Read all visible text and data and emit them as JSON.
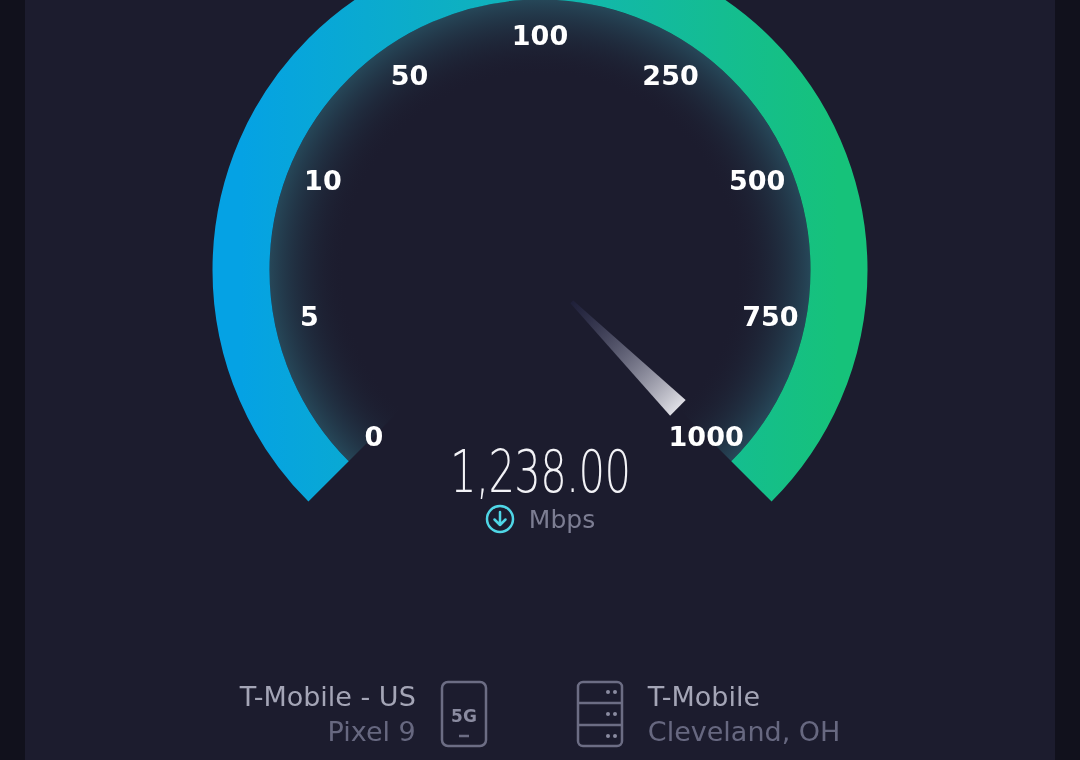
{
  "gauge": {
    "scale": [
      "0",
      "5",
      "10",
      "50",
      "100",
      "250",
      "500",
      "750",
      "1000"
    ]
  },
  "reading": {
    "value": "1,238.00",
    "unit": "Mbps"
  },
  "provider": {
    "name": "T-Mobile - US",
    "device": "Pixel 9",
    "network": "5G"
  },
  "server": {
    "name": "T-Mobile",
    "location": "Cleveland, OH"
  }
}
